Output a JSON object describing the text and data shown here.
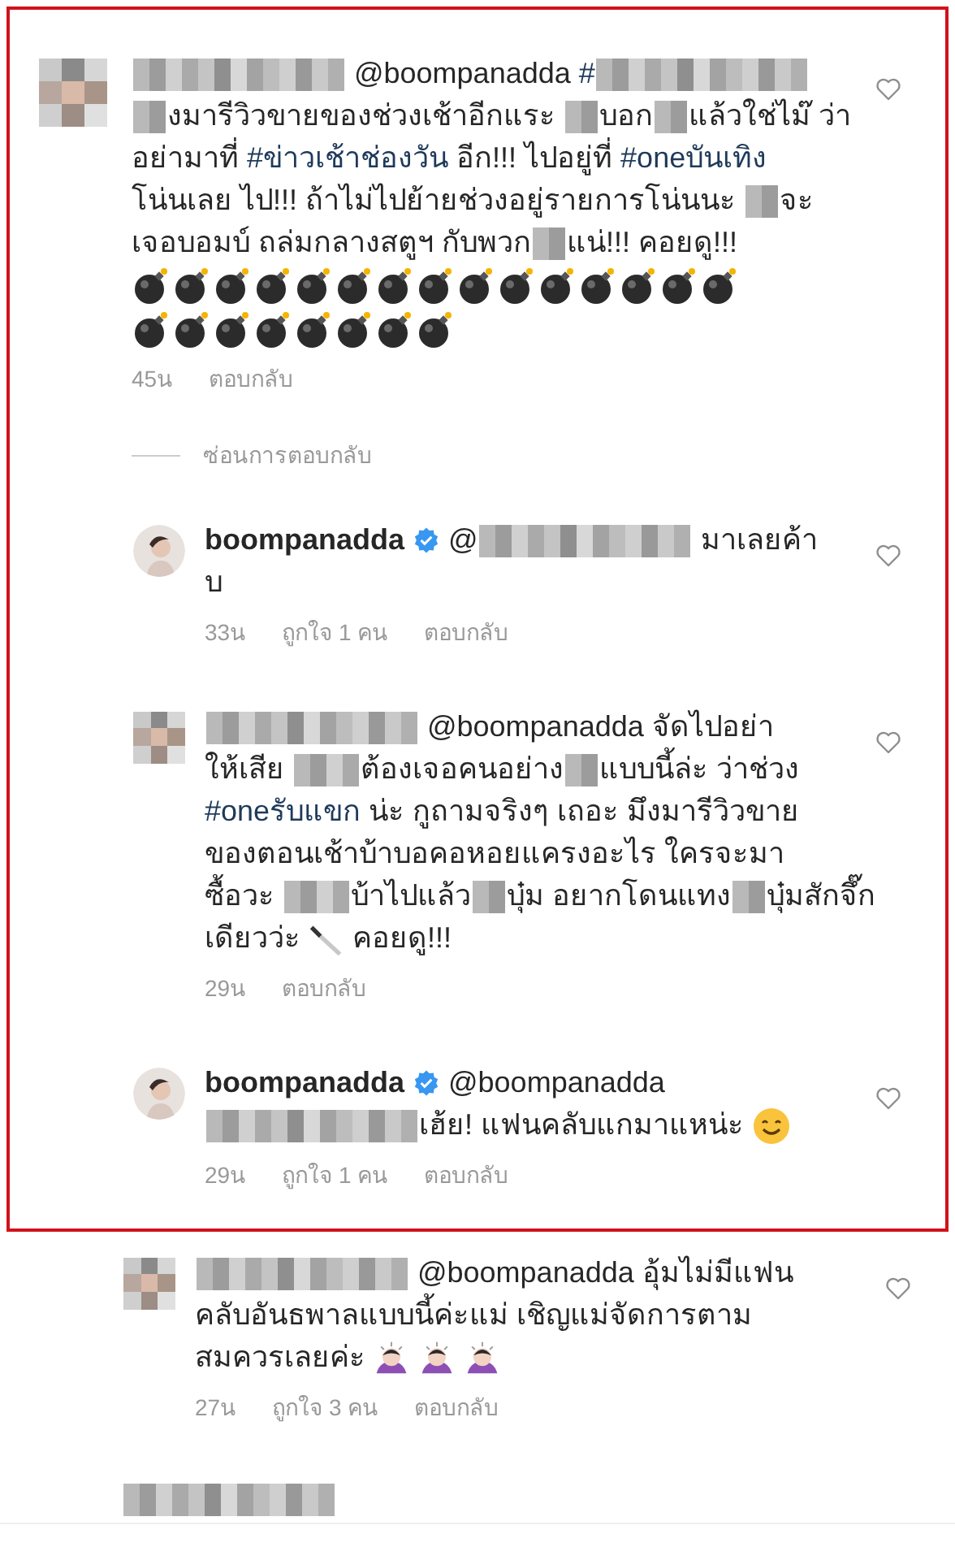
{
  "thread": {
    "comment": {
      "avatar": {
        "kind": "blurred"
      },
      "author": {
        "kind": "blurred"
      },
      "lines": [
        [
          {
            "kind": "mention",
            "text": " @boompanadda"
          },
          {
            "kind": "link",
            "text": " #"
          },
          {
            "kind": "blurlong"
          }
        ],
        [
          {
            "kind": "blurshort"
          },
          {
            "kind": "text",
            "text": "งมารีวิวขายของช่วงเช้าอีกแระ "
          },
          {
            "kind": "blurshort"
          },
          {
            "kind": "text",
            "text": "บอก"
          },
          {
            "kind": "blurshort"
          },
          {
            "kind": "text",
            "text": "แล้วใช่ไม๊ ว่า"
          }
        ],
        [
          {
            "kind": "text",
            "text": "อย่ามาที่ "
          },
          {
            "kind": "link",
            "text": "#ข่าวเช้าช่องวัน"
          },
          {
            "kind": "text",
            "text": " อีก!!! ไปอยู่ที่ "
          },
          {
            "kind": "link",
            "text": "#oneบันเทิง"
          }
        ],
        [
          {
            "kind": "text",
            "text": "โน่นเลย ไป!!! ถ้าไม่ไปย้ายช่วงอยู่รายการโน่นนะ "
          },
          {
            "kind": "blurshort"
          },
          {
            "kind": "text",
            "text": "จะ"
          }
        ],
        [
          {
            "kind": "text",
            "text": "เจอบอมบ์ ถล่มกลางสตูฯ กับพวก"
          },
          {
            "kind": "blurshort"
          },
          {
            "kind": "text",
            "text": "แน่!!! คอยดู!!!"
          }
        ],
        [
          {
            "kind": "bomb"
          },
          {
            "kind": "bomb"
          },
          {
            "kind": "bomb"
          },
          {
            "kind": "bomb"
          },
          {
            "kind": "bomb"
          },
          {
            "kind": "bomb"
          },
          {
            "kind": "bomb"
          },
          {
            "kind": "bomb"
          },
          {
            "kind": "bomb"
          },
          {
            "kind": "bomb"
          },
          {
            "kind": "bomb"
          },
          {
            "kind": "bomb"
          },
          {
            "kind": "bomb"
          },
          {
            "kind": "bomb"
          },
          {
            "kind": "bomb"
          }
        ],
        [
          {
            "kind": "bomb"
          },
          {
            "kind": "bomb"
          },
          {
            "kind": "bomb"
          },
          {
            "kind": "bomb"
          },
          {
            "kind": "bomb"
          },
          {
            "kind": "bomb"
          },
          {
            "kind": "bomb"
          },
          {
            "kind": "bomb"
          }
        ]
      ],
      "time": "45น",
      "reply": "ตอบกลับ"
    },
    "toggle": "ซ่อนการตอบกลับ",
    "replies": [
      {
        "highlighted": true,
        "avatar": {
          "kind": "photo"
        },
        "author": {
          "kind": "name",
          "text": "boompanadda",
          "verified": true
        },
        "lines": [
          [
            {
              "kind": "text",
              "text": " @"
            },
            {
              "kind": "blurlong"
            },
            {
              "kind": "text",
              "text": " มาเลยค้า"
            }
          ],
          [
            {
              "kind": "text",
              "text": "บ"
            }
          ]
        ],
        "time": "33น",
        "likes": "ถูกใจ 1 คน",
        "reply": "ตอบกลับ"
      },
      {
        "highlighted": true,
        "avatar": {
          "kind": "blurred"
        },
        "author": {
          "kind": "blurred"
        },
        "lines": [
          [
            {
              "kind": "mention",
              "text": " @boompanadda"
            },
            {
              "kind": "text",
              "text": " จัดไปอย่า"
            }
          ],
          [
            {
              "kind": "text",
              "text": "ให้เสีย "
            },
            {
              "kind": "blur"
            },
            {
              "kind": "text",
              "text": "ต้องเจอคนอย่าง"
            },
            {
              "kind": "blurshort"
            },
            {
              "kind": "text",
              "text": "แบบนี้ล่ะ ว่าช่วง"
            }
          ],
          [
            {
              "kind": "link",
              "text": "#oneรับแขก"
            },
            {
              "kind": "text",
              "text": " น่ะ กูถามจริงๆ เถอะ มึงมารีวิวขาย"
            }
          ],
          [
            {
              "kind": "text",
              "text": "ของตอนเช้าบ้าบอคอหอยแครงอะไร ใครจะมา"
            }
          ],
          [
            {
              "kind": "text",
              "text": "ซื้อวะ "
            },
            {
              "kind": "blur"
            },
            {
              "kind": "text",
              "text": "บ้าไปแล้ว"
            },
            {
              "kind": "blurshort"
            },
            {
              "kind": "text",
              "text": "บุ๋ม อยากโดนแทง"
            },
            {
              "kind": "blurshort"
            },
            {
              "kind": "text",
              "text": "บุ๋มสักจึ๊ก"
            }
          ],
          [
            {
              "kind": "text",
              "text": "เดียวว่ะ "
            },
            {
              "kind": "knife"
            },
            {
              "kind": "text",
              "text": " คอยดู!!!"
            }
          ]
        ],
        "time": "29น",
        "reply": "ตอบกลับ"
      },
      {
        "highlighted": true,
        "avatar": {
          "kind": "photo"
        },
        "author": {
          "kind": "name",
          "text": "boompanadda",
          "verified": true
        },
        "lines": [
          [
            {
              "kind": "mention",
              "text": " @boompanadda"
            }
          ],
          [
            {
              "kind": "blurlong"
            },
            {
              "kind": "text",
              "text": "เฮ้ย! แฟนคลับแกมาแหน่ะ "
            },
            {
              "kind": "smile"
            }
          ]
        ],
        "time": "29น",
        "likes": "ถูกใจ 1 คน",
        "reply": "ตอบกลับ"
      },
      {
        "highlighted": false,
        "avatar": {
          "kind": "blurred"
        },
        "author": {
          "kind": "blurred"
        },
        "lines": [
          [
            {
              "kind": "mention",
              "text": " @boompanadda"
            },
            {
              "kind": "text",
              "text": " อุ้มไม่มีแฟน"
            }
          ],
          [
            {
              "kind": "text",
              "text": "คลับอันธพาลแบบนี้ค่ะแม่ เชิญแม่จัดการตาม"
            }
          ],
          [
            {
              "kind": "text",
              "text": "สมควรเลยค่ะ "
            },
            {
              "kind": "bow"
            },
            {
              "kind": "bow"
            },
            {
              "kind": "bow"
            }
          ]
        ],
        "time": "27น",
        "likes": "ถูกใจ 3 คน",
        "reply": "ตอบกลับ"
      }
    ]
  },
  "next_comment": {
    "kind": "blurred"
  }
}
